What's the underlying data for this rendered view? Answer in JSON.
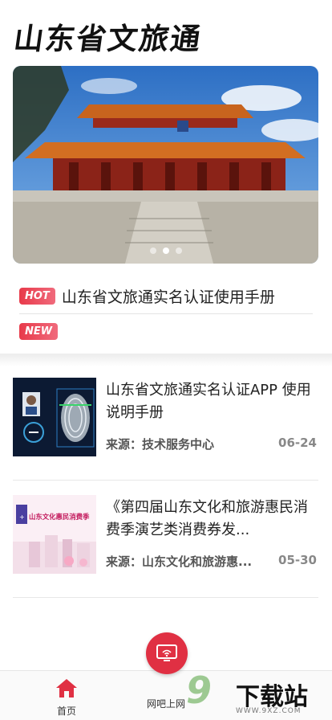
{
  "header": {
    "title": "山东省文旅通"
  },
  "banner": {
    "slide_count": 3,
    "active_index": 1
  },
  "notices": [
    {
      "badge": "HOT",
      "text": "山东省文旅通实名认证使用手册"
    },
    {
      "badge": "NEW",
      "text": ""
    }
  ],
  "articles": [
    {
      "title": "山东省文旅通实名认证APP 使用说明手册",
      "source": "来源：技术服务中心",
      "date": "06-24"
    },
    {
      "title": "《第四届山东文化和旅游惠民消费季演艺类消费券发...",
      "source": "来源：山东文化和旅游惠...",
      "date": "05-30",
      "thumb_text": "山东文化惠民消费季"
    }
  ],
  "bottom_nav": {
    "home": "首页",
    "netbar": "网吧上网"
  },
  "watermark": {
    "num": "9",
    "text": "下载站",
    "url": "WWW.9XZ.COM"
  },
  "colors": {
    "accent": "#e03043",
    "badge_start": "#e83a4a",
    "badge_end": "#f06a7c"
  }
}
